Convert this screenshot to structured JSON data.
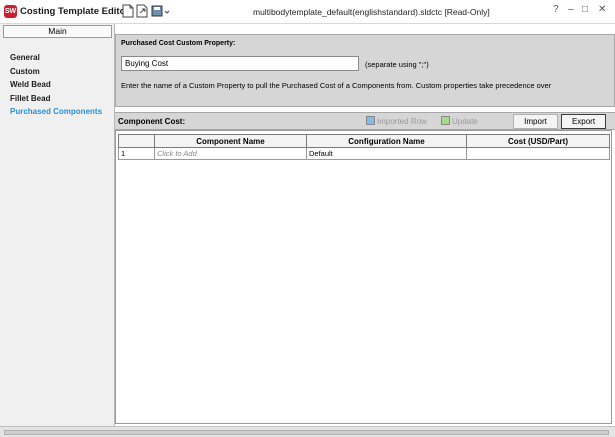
{
  "titlebar": {
    "app_title": "Costing Template Editor",
    "document_title": "multibodytemplate_default(englishstandard).sldctc [Read-Only]",
    "help": "?",
    "minimize": "–",
    "maximize": "□",
    "close": "✕"
  },
  "sidebar": {
    "main_tab": "Main",
    "items": [
      {
        "label": "General"
      },
      {
        "label": "Custom"
      },
      {
        "label": "Weld Bead"
      },
      {
        "label": "Fillet Bead"
      },
      {
        "label": "Purchased Components"
      }
    ],
    "active_index": 4
  },
  "purchased_cost": {
    "label": "Purchased Cost Custom Property:",
    "input_value": "Buying Cost",
    "separator_hint": "(separate using \";\")",
    "description": "Enter the name of a Custom Property to pull the Purchased Cost of a Components from. Custom properties take precedence over"
  },
  "component_cost": {
    "label": "Component Cost:",
    "imported_row": "Imported Row",
    "update": "Update",
    "import_button": "Import",
    "export_button": "Export",
    "imported_row_color": "#86b8ea",
    "update_color": "#a9d98a"
  },
  "table": {
    "columns": [
      "",
      "Component Name",
      "Configuration Name",
      "Cost (USD/Part)"
    ],
    "rows": [
      {
        "num": "1",
        "component": "Click to Add",
        "configuration": "Default",
        "cost": ""
      }
    ]
  },
  "colors": {
    "accent": "#2a8fd6",
    "logo": "#c8202f",
    "panel": "#d6d6d6"
  }
}
